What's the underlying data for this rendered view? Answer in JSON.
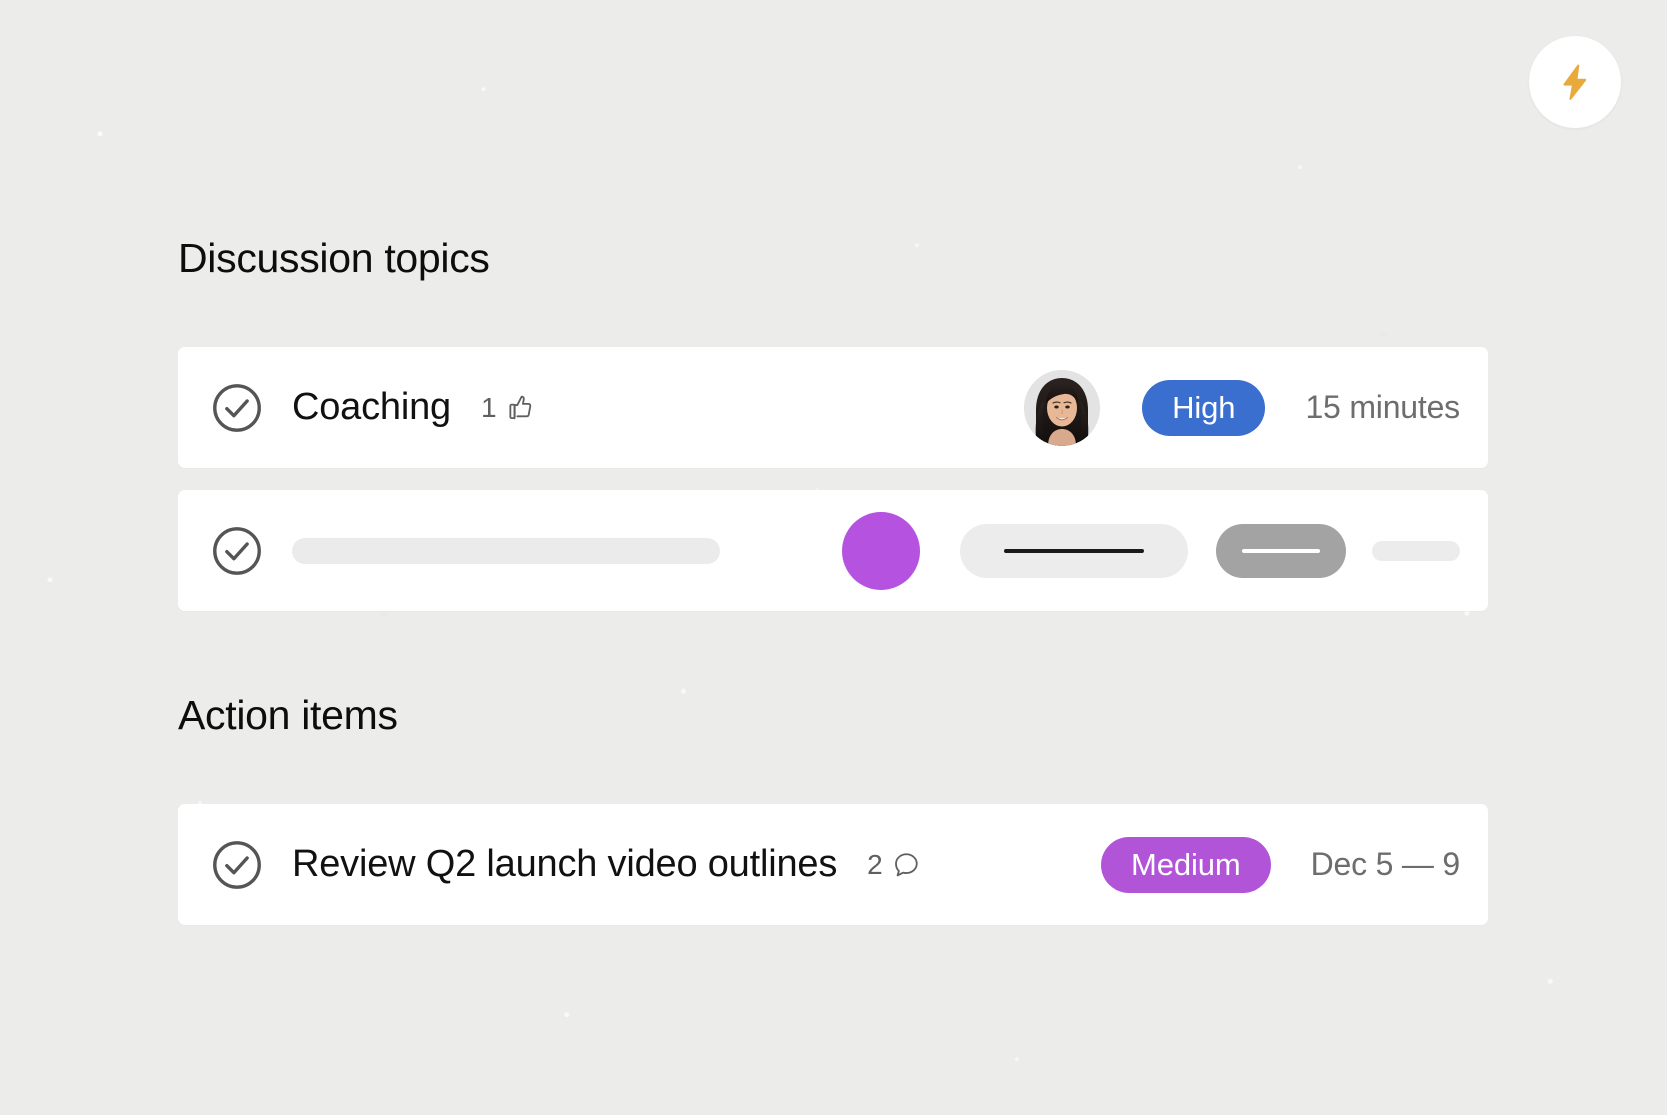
{
  "app": {
    "background_color": "#ececeb",
    "fab": {
      "icon": "lightning-bolt-icon",
      "icon_color": "#e8a93d",
      "background_color": "#ffffff"
    }
  },
  "sections": [
    {
      "title": "Discussion topics",
      "rows": [
        {
          "type": "content",
          "check_icon": "check-circle-icon",
          "title": "Coaching",
          "reaction_count": "1",
          "reaction_icon": "thumbs-up-icon",
          "avatar": "user-avatar",
          "badge": {
            "label": "High",
            "color": "#3a6fd0"
          },
          "duration": "15 minutes"
        },
        {
          "type": "skeleton",
          "check_icon": "check-circle-icon",
          "avatar_color": "#b552e0",
          "pill_light_color": "#ececec",
          "pill_dark_color": "#a3a3a3"
        }
      ]
    },
    {
      "title": "Action items",
      "rows": [
        {
          "type": "content",
          "check_icon": "check-circle-icon",
          "title": "Review Q2 launch video outlines",
          "reaction_count": "2",
          "reaction_icon": "comment-bubble-icon",
          "badge": {
            "label": "Medium",
            "color": "#b254d8"
          },
          "date_range": "Dec 5 — 9"
        }
      ]
    }
  ]
}
